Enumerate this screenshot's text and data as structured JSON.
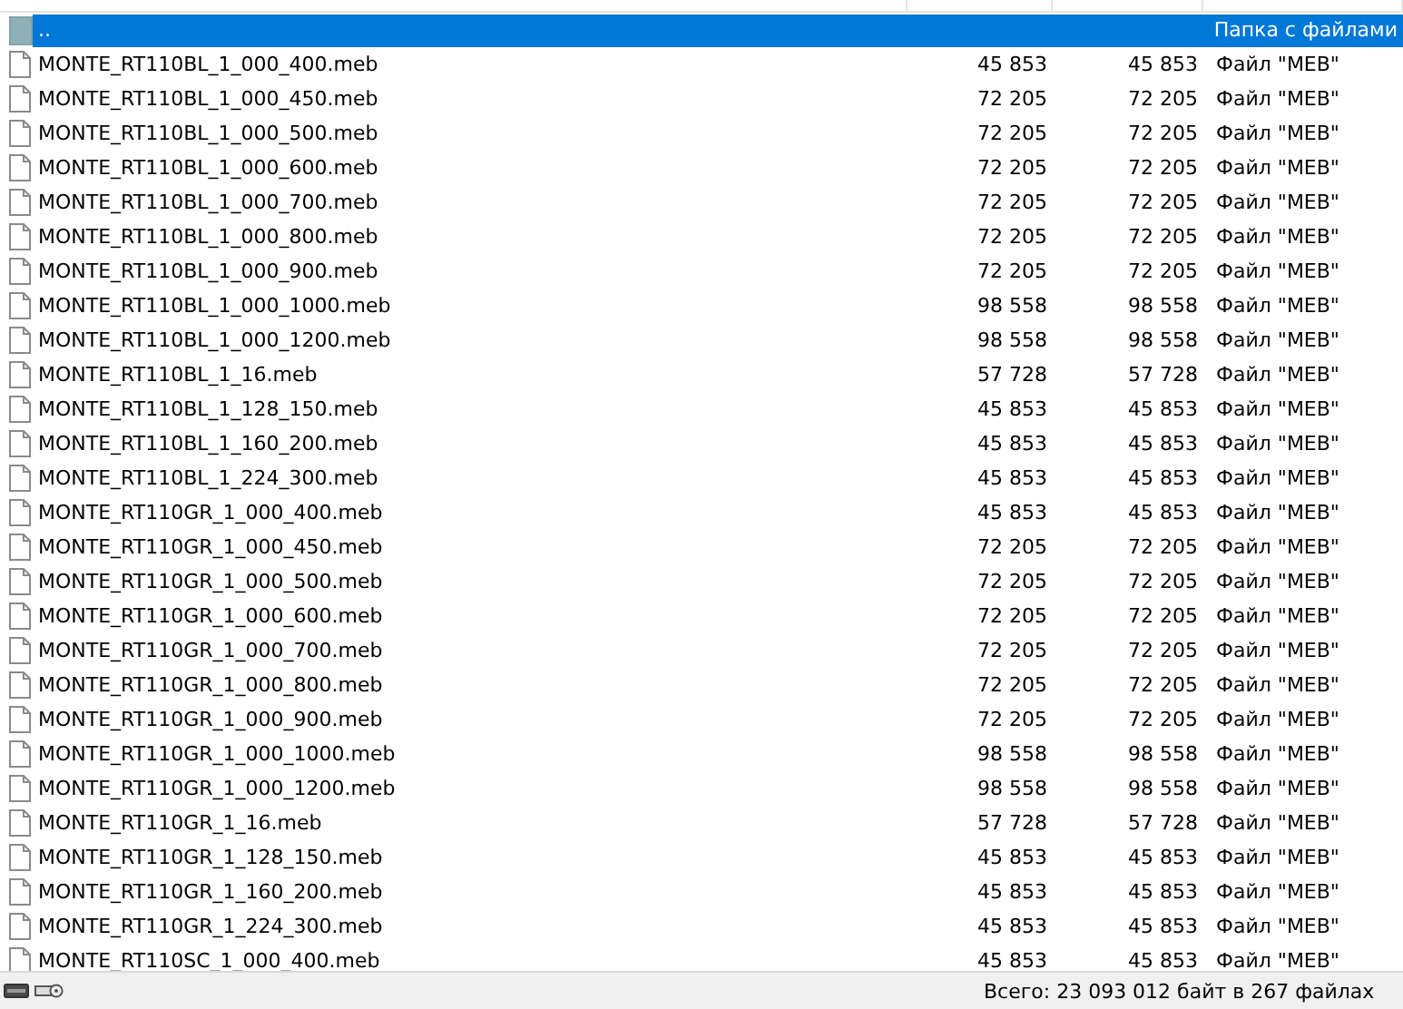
{
  "parent_row": {
    "name": "..",
    "type": "Папка с файлами",
    "selected": true
  },
  "files": [
    {
      "name": "MONTE_RT110BL_1_000_400.meb",
      "size": "45 853",
      "packed": "45 853",
      "type": "Файл \"MEB\"",
      "selected": false
    },
    {
      "name": "MONTE_RT110BL_1_000_450.meb",
      "size": "72 205",
      "packed": "72 205",
      "type": "Файл \"MEB\"",
      "selected": false
    },
    {
      "name": "MONTE_RT110BL_1_000_500.meb",
      "size": "72 205",
      "packed": "72 205",
      "type": "Файл \"MEB\"",
      "selected": false
    },
    {
      "name": "MONTE_RT110BL_1_000_600.meb",
      "size": "72 205",
      "packed": "72 205",
      "type": "Файл \"MEB\"",
      "selected": false
    },
    {
      "name": "MONTE_RT110BL_1_000_700.meb",
      "size": "72 205",
      "packed": "72 205",
      "type": "Файл \"MEB\"",
      "selected": false
    },
    {
      "name": "MONTE_RT110BL_1_000_800.meb",
      "size": "72 205",
      "packed": "72 205",
      "type": "Файл \"MEB\"",
      "selected": false
    },
    {
      "name": "MONTE_RT110BL_1_000_900.meb",
      "size": "72 205",
      "packed": "72 205",
      "type": "Файл \"MEB\"",
      "selected": false
    },
    {
      "name": "MONTE_RT110BL_1_000_1000.meb",
      "size": "98 558",
      "packed": "98 558",
      "type": "Файл \"MEB\"",
      "selected": false
    },
    {
      "name": "MONTE_RT110BL_1_000_1200.meb",
      "size": "98 558",
      "packed": "98 558",
      "type": "Файл \"MEB\"",
      "selected": false
    },
    {
      "name": "MONTE_RT110BL_1_16.meb",
      "size": "57 728",
      "packed": "57 728",
      "type": "Файл \"MEB\"",
      "selected": false
    },
    {
      "name": "MONTE_RT110BL_1_128_150.meb",
      "size": "45 853",
      "packed": "45 853",
      "type": "Файл \"MEB\"",
      "selected": false
    },
    {
      "name": "MONTE_RT110BL_1_160_200.meb",
      "size": "45 853",
      "packed": "45 853",
      "type": "Файл \"MEB\"",
      "selected": false
    },
    {
      "name": "MONTE_RT110BL_1_224_300.meb",
      "size": "45 853",
      "packed": "45 853",
      "type": "Файл \"MEB\"",
      "selected": false
    },
    {
      "name": "MONTE_RT110GR_1_000_400.meb",
      "size": "45 853",
      "packed": "45 853",
      "type": "Файл \"MEB\"",
      "selected": false
    },
    {
      "name": "MONTE_RT110GR_1_000_450.meb",
      "size": "72 205",
      "packed": "72 205",
      "type": "Файл \"MEB\"",
      "selected": false
    },
    {
      "name": "MONTE_RT110GR_1_000_500.meb",
      "size": "72 205",
      "packed": "72 205",
      "type": "Файл \"MEB\"",
      "selected": false
    },
    {
      "name": "MONTE_RT110GR_1_000_600.meb",
      "size": "72 205",
      "packed": "72 205",
      "type": "Файл \"MEB\"",
      "selected": false
    },
    {
      "name": "MONTE_RT110GR_1_000_700.meb",
      "size": "72 205",
      "packed": "72 205",
      "type": "Файл \"MEB\"",
      "selected": false
    },
    {
      "name": "MONTE_RT110GR_1_000_800.meb",
      "size": "72 205",
      "packed": "72 205",
      "type": "Файл \"MEB\"",
      "selected": false
    },
    {
      "name": "MONTE_RT110GR_1_000_900.meb",
      "size": "72 205",
      "packed": "72 205",
      "type": "Файл \"MEB\"",
      "selected": false
    },
    {
      "name": "MONTE_RT110GR_1_000_1000.meb",
      "size": "98 558",
      "packed": "98 558",
      "type": "Файл \"MEB\"",
      "selected": false
    },
    {
      "name": "MONTE_RT110GR_1_000_1200.meb",
      "size": "98 558",
      "packed": "98 558",
      "type": "Файл \"MEB\"",
      "selected": false
    },
    {
      "name": "MONTE_RT110GR_1_16.meb",
      "size": "57 728",
      "packed": "57 728",
      "type": "Файл \"MEB\"",
      "selected": false
    },
    {
      "name": "MONTE_RT110GR_1_128_150.meb",
      "size": "45 853",
      "packed": "45 853",
      "type": "Файл \"MEB\"",
      "selected": false
    },
    {
      "name": "MONTE_RT110GR_1_160_200.meb",
      "size": "45 853",
      "packed": "45 853",
      "type": "Файл \"MEB\"",
      "selected": false
    },
    {
      "name": "MONTE_RT110GR_1_224_300.meb",
      "size": "45 853",
      "packed": "45 853",
      "type": "Файл \"MEB\"",
      "selected": false
    },
    {
      "name": "MONTE_RT110SC_1_000_400.meb",
      "size": "45 853",
      "packed": "45 853",
      "type": "Файл \"MEB\"",
      "selected": false
    }
  ],
  "status_bar": {
    "summary": "Всего: 23 093 012 байт в 267 файлах"
  }
}
